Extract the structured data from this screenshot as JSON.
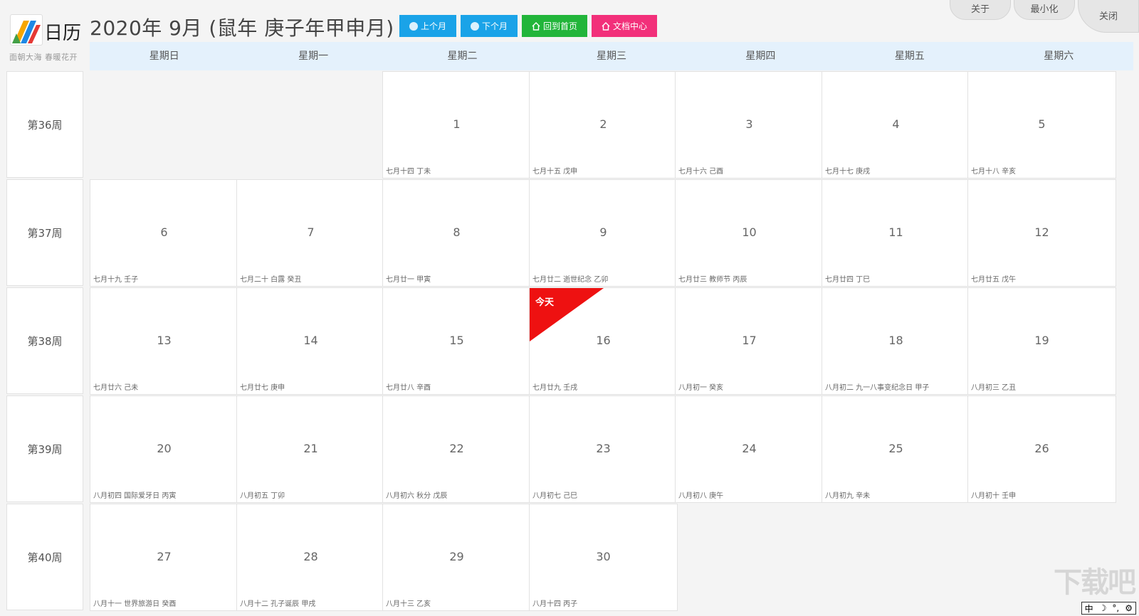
{
  "app": {
    "logo_text": "日历",
    "slogan": "面朝大海  春暖花开",
    "title": "2020年 9月 (鼠年 庚子年甲申月)"
  },
  "nav": {
    "prev_month": "上个月",
    "next_month": "下个月",
    "home": "回到首页",
    "docs": "文档中心"
  },
  "window": {
    "about": "关于",
    "minimize": "最小化",
    "close": "关闭"
  },
  "colors": {
    "header_bg": "#e4f1fc",
    "btn_blue": "#1aa3e8",
    "btn_green": "#22b53a",
    "btn_pink": "#f2307a",
    "today_red": "#ee1111"
  },
  "weekdays": [
    "星期日",
    "星期一",
    "星期二",
    "星期三",
    "星期四",
    "星期五",
    "星期六"
  ],
  "weeks": [
    "第36周",
    "第37周",
    "第38周",
    "第39周",
    "第40周"
  ],
  "today_label": "今天",
  "days": [
    {
      "day": "",
      "lunar": "",
      "empty": true
    },
    {
      "day": "",
      "lunar": "",
      "empty": true
    },
    {
      "day": "1",
      "lunar": "七月十四   丁未"
    },
    {
      "day": "2",
      "lunar": "七月十五   戊申"
    },
    {
      "day": "3",
      "lunar": "七月十六   己酉"
    },
    {
      "day": "4",
      "lunar": "七月十七   庚戌"
    },
    {
      "day": "5",
      "lunar": "七月十八   辛亥"
    },
    {
      "day": "6",
      "lunar": "七月十九   壬子"
    },
    {
      "day": "7",
      "lunar": "七月二十 白露  癸丑"
    },
    {
      "day": "8",
      "lunar": "七月廿一   甲寅"
    },
    {
      "day": "9",
      "lunar": "七月廿二   逝世纪念 乙卯"
    },
    {
      "day": "10",
      "lunar": "七月廿三  教师节 丙辰"
    },
    {
      "day": "11",
      "lunar": "七月廿四   丁巳"
    },
    {
      "day": "12",
      "lunar": "七月廿五   戊午"
    },
    {
      "day": "13",
      "lunar": "七月廿六   己未"
    },
    {
      "day": "14",
      "lunar": "七月廿七   庚申"
    },
    {
      "day": "15",
      "lunar": "七月廿八   辛酉"
    },
    {
      "day": "16",
      "lunar": "七月廿九   壬戌",
      "today": true
    },
    {
      "day": "17",
      "lunar": "八月初一   癸亥"
    },
    {
      "day": "18",
      "lunar": "八月初二  九一八事变纪念日 甲子"
    },
    {
      "day": "19",
      "lunar": "八月初三   乙丑"
    },
    {
      "day": "20",
      "lunar": "八月初四  国际爱牙日 丙寅"
    },
    {
      "day": "21",
      "lunar": "八月初五   丁卯"
    },
    {
      "day": "22",
      "lunar": "八月初六 秋分  戊辰"
    },
    {
      "day": "23",
      "lunar": "八月初七   己巳"
    },
    {
      "day": "24",
      "lunar": "八月初八   庚午"
    },
    {
      "day": "25",
      "lunar": "八月初九   辛未"
    },
    {
      "day": "26",
      "lunar": "八月初十   壬申"
    },
    {
      "day": "27",
      "lunar": "八月十一  世界旅游日 癸酉"
    },
    {
      "day": "28",
      "lunar": "八月十二  孔子诞辰 甲戌"
    },
    {
      "day": "29",
      "lunar": "八月十三   乙亥"
    },
    {
      "day": "30",
      "lunar": "八月十四   丙子"
    }
  ],
  "watermark": "下载吧",
  "ime": {
    "lang": "中",
    "mode1": "☽",
    "mode2": "°,",
    "settings": "⚙"
  }
}
